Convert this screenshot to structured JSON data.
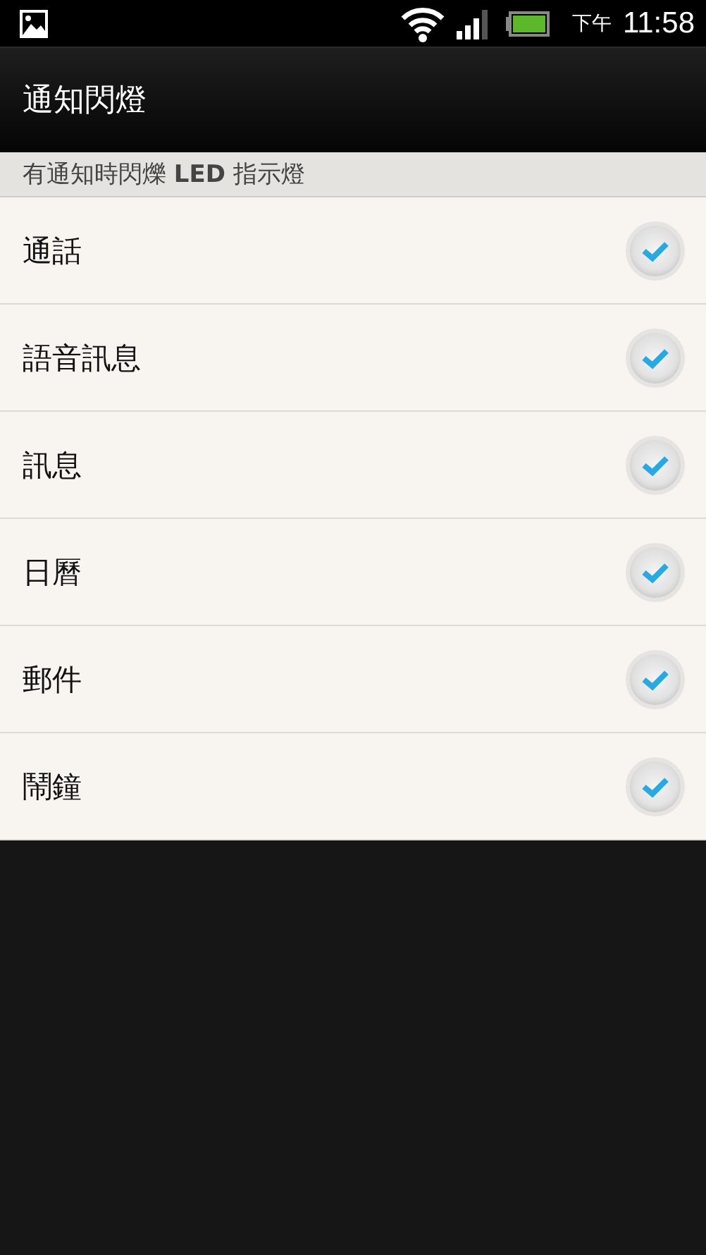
{
  "status_bar": {
    "time_period": "下午",
    "time": "11:58"
  },
  "header": {
    "title": "通知閃燈"
  },
  "section": {
    "title": "有通知時閃爍 **LED** 指示燈"
  },
  "items": [
    {
      "label": "通話",
      "checked": true
    },
    {
      "label": "語音訊息",
      "checked": true
    },
    {
      "label": "訊息",
      "checked": true
    },
    {
      "label": "日曆",
      "checked": true
    },
    {
      "label": "郵件",
      "checked": true
    },
    {
      "label": "鬧鐘",
      "checked": true
    }
  ]
}
